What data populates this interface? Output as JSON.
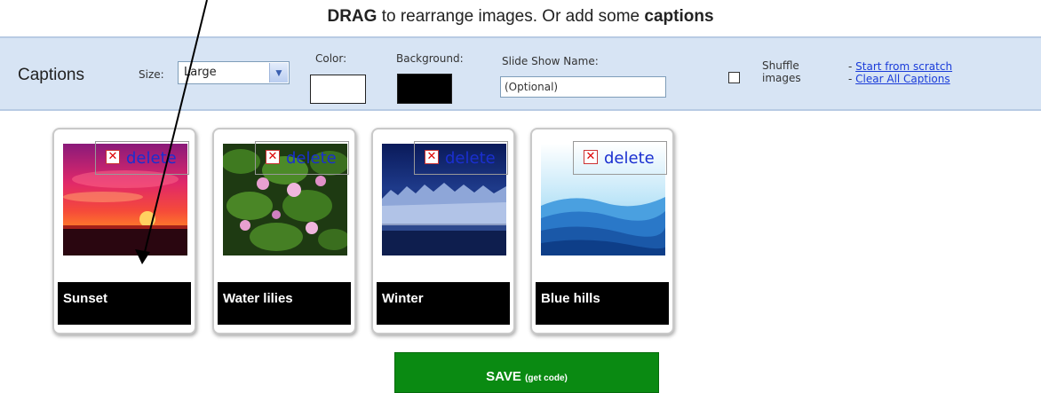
{
  "header": {
    "headline_prefix": "DRAG",
    "headline_middle": " to rearrange images. Or add some ",
    "headline_suffix": "captions"
  },
  "toolbar": {
    "title": "Captions",
    "size_label": "Size:",
    "size_value": "Large",
    "color_label": "Color:",
    "color_value": "#ffffff",
    "background_label": "Background:",
    "background_value": "#000000",
    "slideshow_name_label": "Slide Show Name:",
    "slideshow_name_placeholder": "(Optional)",
    "shuffle_label_line1": "Shuffle",
    "shuffle_label_line2": "images",
    "shuffle_checked": false,
    "link_start": "Start from scratch",
    "link_clear": "Clear All Captions"
  },
  "cards": [
    {
      "caption": "Sunset",
      "delete_label": "delete",
      "image": "sunset-photo"
    },
    {
      "caption": "Water lilies",
      "delete_label": "delete",
      "image": "water-lilies-photo"
    },
    {
      "caption": "Winter",
      "delete_label": "delete",
      "image": "winter-photo"
    },
    {
      "caption": "Blue hills",
      "delete_label": "delete",
      "image": "blue-hills-photo"
    }
  ],
  "save_button": {
    "label": "SAVE",
    "sublabel": "(get code)",
    "color": "#0a8a12"
  }
}
